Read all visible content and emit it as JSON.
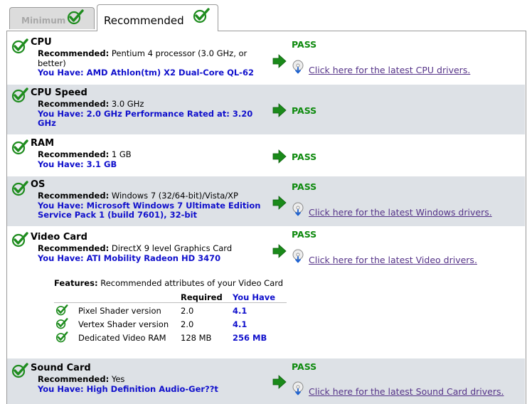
{
  "tabs": [
    {
      "label": "Minimum",
      "status_icon": "check-icon",
      "active": false
    },
    {
      "label": "Recommended",
      "status_icon": "check-icon",
      "active": true
    }
  ],
  "colors": {
    "pass": "#0d8a0d",
    "have_text": "#1010cc",
    "link": "#553388",
    "shaded_row": "#dde1e6",
    "check": "#1e8c1e"
  },
  "requirements": [
    {
      "title": "CPU",
      "rec_label": "Recommended:",
      "rec_value": "Pentium 4 processor (3.0 GHz, or",
      "rec_value_cont": "better)",
      "have_label": "You Have:",
      "have_value": "AMD Athlon(tm) X2 Dual-Core QL-62",
      "status": "PASS",
      "link": "Click here for the latest CPU drivers."
    },
    {
      "title": "CPU Speed",
      "rec_label": "Recommended:",
      "rec_value": "3.0 GHz",
      "have_label": "You Have:",
      "have_value": "2.0 GHz Performance Rated at: 3.20",
      "have_value_cont": "GHz",
      "status": "PASS"
    },
    {
      "title": "RAM",
      "rec_label": "Recommended:",
      "rec_value": "1 GB",
      "have_label": "You Have:",
      "have_value": "3.1 GB",
      "status": "PASS"
    },
    {
      "title": "OS",
      "rec_label": "Recommended:",
      "rec_value": "Windows 7 (32/64-bit)/Vista/XP",
      "have_label": "You Have:",
      "have_value": "Microsoft Windows 7 Ultimate Edition",
      "have_value_cont": "Service Pack 1 (build 7601), 32-bit",
      "status": "PASS",
      "link": "Click here for the latest Windows drivers."
    },
    {
      "title": "Video Card",
      "rec_label": "Recommended:",
      "rec_value": "DirectX 9 level Graphics Card",
      "have_label": "You Have:",
      "have_value": "ATI Mobility Radeon HD 3470",
      "status": "PASS",
      "link": "Click here for the latest Video drivers."
    },
    {
      "title": "Sound Card",
      "rec_label": "Recommended:",
      "rec_value": "Yes",
      "have_label": "You Have:",
      "have_value": "High Definition Audio-Ger??t",
      "status": "PASS",
      "link": "Click here for the latest Sound Card drivers."
    }
  ],
  "features": {
    "label": "Features:",
    "description": "Recommended attributes of your Video Card",
    "col_required": "Required",
    "col_have": "You Have",
    "rows": [
      {
        "name": "Pixel Shader version",
        "required": "2.0",
        "have": "4.1"
      },
      {
        "name": "Vertex Shader version",
        "required": "2.0",
        "have": "4.1"
      },
      {
        "name": "Dedicated Video RAM",
        "required": "128 MB",
        "have": "256 MB"
      }
    ]
  }
}
